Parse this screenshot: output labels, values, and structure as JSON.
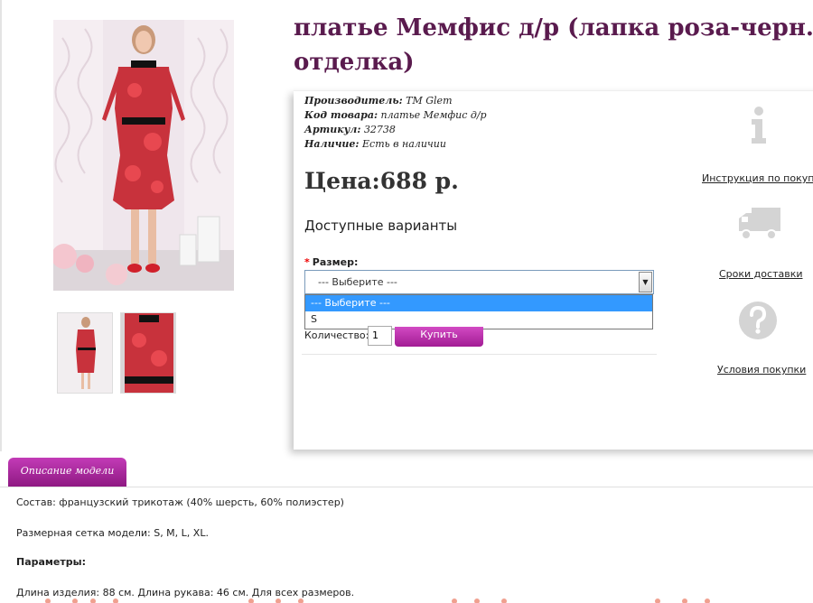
{
  "product": {
    "title_line1": "платье Мемфис д/р (лапка роза-черн.",
    "title_line2": "отделка)"
  },
  "meta": {
    "manufacturer_label": "Производитель:",
    "manufacturer_value": "ТМ Glem",
    "code_label": "Код товара:",
    "code_value": "платье Мемфис д/р",
    "sku_label": "Артикул:",
    "sku_value": "32738",
    "stock_label": "Наличие:",
    "stock_value": "Есть в наличии"
  },
  "price": "Цена:688 р.",
  "variants_heading": "Доступные варианты",
  "size": {
    "required_mark": "*",
    "label": "Размер:",
    "selected": "--- Выберите ---",
    "arrow": "▼",
    "options": [
      "--- Выберите ---",
      "S"
    ]
  },
  "purchase": {
    "qty_label": "Количество:",
    "qty_value": "1",
    "buy_label": "Купить"
  },
  "side": {
    "instruction_link": "Инструкция по покупке",
    "delivery_link": "Сроки доставки",
    "terms_link": "Условия покупки"
  },
  "tabs": {
    "description_tab": "Описание модели"
  },
  "description": {
    "composition": "Состав: французский трикотаж (40% шерсть, 60% полиэстер)",
    "sizes": "Размерная сетка модели: S, M, L, XL.",
    "params_heading": "Параметры:",
    "lengths": "Длина изделия: 88 см. Длина рукава: 46 см. Для всех размеров."
  },
  "colors": {
    "title": "#5a1b4e",
    "accent": "#a21c94",
    "selected_option": "#3399ff",
    "dress_red": "#d02c36"
  }
}
